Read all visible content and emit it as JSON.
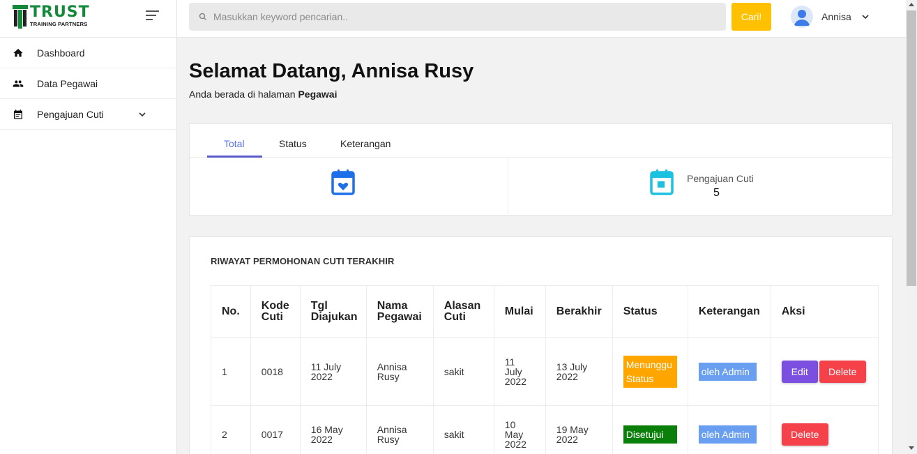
{
  "brand": {
    "word": "TRUST",
    "sub": "TRAINING PARTNERS"
  },
  "sidebar": {
    "items": [
      {
        "label": "Dashboard",
        "icon": "home-icon"
      },
      {
        "label": "Data Pegawai",
        "icon": "people-icon"
      },
      {
        "label": "Pengajuan Cuti",
        "icon": "calendar-list-icon",
        "has_dropdown": true
      }
    ]
  },
  "topbar": {
    "search_placeholder": "Masukkan keyword pencarian..",
    "search_button": "Cari!",
    "user_name": "Annisa"
  },
  "main": {
    "welcome": "Selamat Datang, Annisa Rusy",
    "subtitle_prefix": "Anda berada di halaman ",
    "subtitle_page": "Pegawai",
    "tabs": [
      "Total",
      "Status",
      "Keterangan"
    ],
    "active_tab": "Total",
    "stat": {
      "label": "Pengajuan Cuti",
      "value": "5"
    }
  },
  "history": {
    "title": "RIWAYAT PERMOHONAN CUTI TERAKHIR",
    "columns": [
      "No.",
      "Kode Cuti",
      "Tgl Diajukan",
      "Nama Pegawai",
      "Alasan Cuti",
      "Mulai",
      "Berakhir",
      "Status",
      "Keterangan",
      "Aksi"
    ],
    "rows": [
      {
        "no": "1",
        "kode": "0018",
        "tgl": "11 July 2022",
        "nama": "Annisa Rusy",
        "alasan": "sakit",
        "mulai": "11 July 2022",
        "berakhir": "13 July 2022",
        "status": "Menunggu Status",
        "keterangan": "oleh Admin",
        "edit": "Edit",
        "delete": "Delete"
      },
      {
        "no": "2",
        "kode": "0017",
        "tgl": "16 May 2022",
        "nama": "Annisa Rusy",
        "alasan": "sakit",
        "mulai": "10 May 2022",
        "berakhir": "19 May 2022",
        "status": "Disetujui",
        "keterangan": "oleh Admin",
        "delete": "Delete"
      }
    ]
  },
  "colors": {
    "accent_tab": "#5b74e6",
    "search_button": "#ffc000",
    "status_waiting": "#ffa500",
    "status_approved": "#0a7f0a",
    "keterangan_badge": "#6a9ef0",
    "edit_button": "#7b4fe0",
    "delete_button": "#f4414a",
    "brand_green": "#138a3a"
  }
}
